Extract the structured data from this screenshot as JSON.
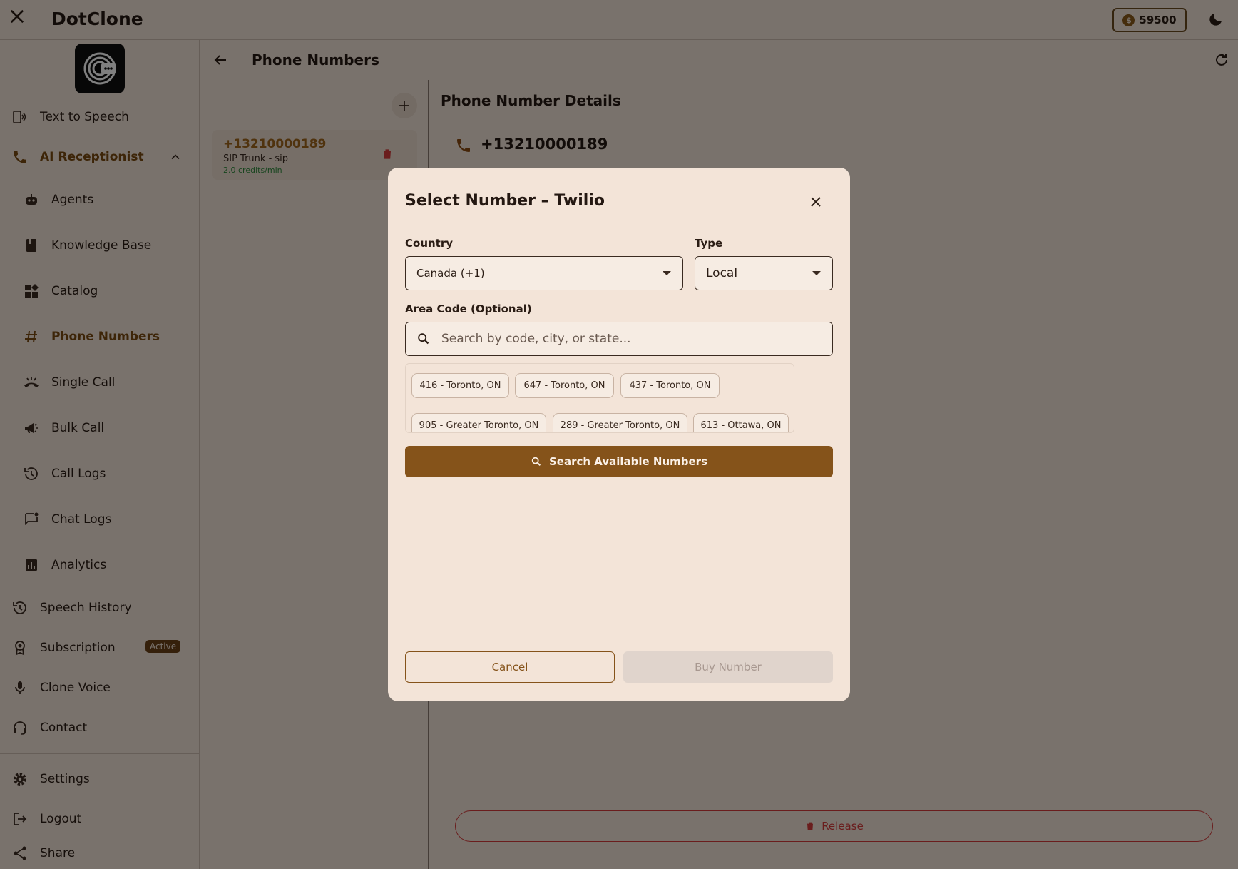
{
  "app": {
    "title": "DotClone",
    "credits": "59500",
    "coin_symbol": "$"
  },
  "sidebar": {
    "items": [
      {
        "key": "tts",
        "label": "Text to Speech",
        "icon": "speaker-doc-icon"
      },
      {
        "key": "ai",
        "label": "AI Receptionist",
        "icon": "phone-icon"
      },
      {
        "key": "agents",
        "label": "Agents",
        "icon": "robot-icon"
      },
      {
        "key": "kb",
        "label": "Knowledge Base",
        "icon": "book-icon"
      },
      {
        "key": "catalog",
        "label": "Catalog",
        "icon": "widgets-icon"
      },
      {
        "key": "phones",
        "label": "Phone Numbers",
        "icon": "hash-icon"
      },
      {
        "key": "single",
        "label": "Single Call",
        "icon": "call-ring-icon"
      },
      {
        "key": "bulk",
        "label": "Bulk Call",
        "icon": "megaphone-icon"
      },
      {
        "key": "calllogs",
        "label": "Call Logs",
        "icon": "history-icon"
      },
      {
        "key": "chatlogs",
        "label": "Chat Logs",
        "icon": "chat-icon"
      },
      {
        "key": "analytics",
        "label": "Analytics",
        "icon": "analytics-icon"
      },
      {
        "key": "speech",
        "label": "Speech History",
        "icon": "history-icon"
      },
      {
        "key": "sub",
        "label": "Subscription",
        "icon": "award-icon",
        "badge": "Active"
      },
      {
        "key": "clone",
        "label": "Clone Voice",
        "icon": "mic-icon"
      },
      {
        "key": "contact",
        "label": "Contact",
        "icon": "headset-icon"
      },
      {
        "key": "settings",
        "label": "Settings",
        "icon": "gear-icon"
      },
      {
        "key": "logout",
        "label": "Logout",
        "icon": "logout-icon"
      },
      {
        "key": "share",
        "label": "Share",
        "icon": "share-icon"
      }
    ]
  },
  "main": {
    "title": "Phone Numbers",
    "list": [
      {
        "number": "+13210000189",
        "subtitle": "SIP Trunk - sip",
        "credits": "2.0 credits/min"
      }
    ],
    "details_title": "Phone Number Details",
    "details_number": "+13210000189",
    "release_label": "Release"
  },
  "dialog": {
    "title": "Select Number – Twilio",
    "country_label": "Country",
    "country_value": "Canada (+1)",
    "type_label": "Type",
    "type_value": "Local",
    "area_label": "Area Code (Optional)",
    "area_placeholder": "Search by code, city, or state...",
    "chips": [
      "416 - Toronto, ON",
      "647 - Toronto, ON",
      "437 - Toronto, ON",
      "905 - Greater Toronto, ON",
      "289 - Greater Toronto, ON",
      "613 - Ottawa, ON"
    ],
    "search_label": "Search Available Numbers",
    "cancel_label": "Cancel",
    "buy_label": "Buy Number"
  },
  "colors": {
    "accent": "#85531a",
    "background": "#f3e4d8",
    "danger": "#d43a3a",
    "active_text": "#7a4a10"
  }
}
